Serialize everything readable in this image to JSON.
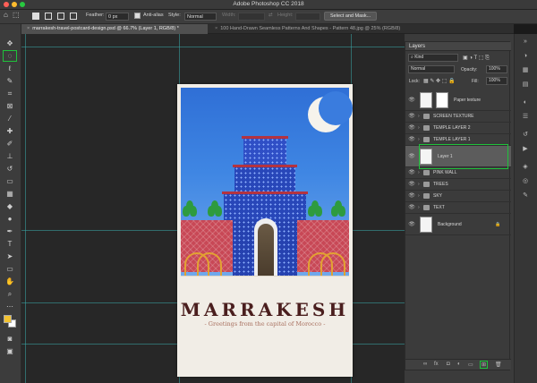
{
  "app": {
    "title": "Adobe Photoshop CC 2018"
  },
  "options_bar": {
    "feather_label": "Feather:",
    "feather_value": "0 px",
    "antialias_label": "Anti-alias",
    "style_label": "Style:",
    "style_value": "Normal",
    "width_label": "Width:",
    "height_label": "Height:",
    "select_mask_label": "Select and Mask..."
  },
  "tabs": [
    {
      "label": "marrakesh-travel-postcard-design.psd @ 66.7% (Layer 1, RGB/8) *"
    },
    {
      "label": "100 Hand-Drawn Seamless Patterns And Shapes - Pattern 48.jpg @ 25% (RGB/8)"
    }
  ],
  "canvas": {
    "city": "MARRAKESH",
    "subtitle": "- Greetings from the capital of Morocco -"
  },
  "layers_panel": {
    "title": "Layers",
    "kind_label": "Kind",
    "blend_mode": "Normal",
    "opacity_label": "Opacity:",
    "opacity_value": "100%",
    "lock_label": "Lock:",
    "fill_label": "Fill:",
    "fill_value": "100%",
    "layers": [
      {
        "name": "Paper texture"
      },
      {
        "name": "SCREEN TEXTURE"
      },
      {
        "name": "TEMPLE LAYER 2"
      },
      {
        "name": "TEMPLE  LAYER 1"
      },
      {
        "name": "Layer 1"
      },
      {
        "name": "PINK WALL"
      },
      {
        "name": "TREES"
      },
      {
        "name": "SKY"
      },
      {
        "name": "TEXT"
      },
      {
        "name": "Background"
      }
    ]
  },
  "colors": {
    "highlight": "#1fc23b",
    "foreground_swatch": "#f2c230",
    "background_swatch": "#ffffff"
  }
}
